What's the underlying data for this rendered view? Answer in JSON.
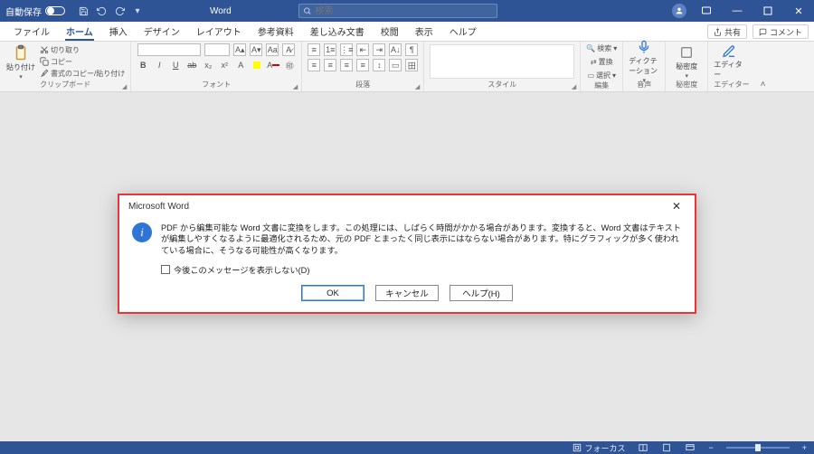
{
  "titlebar": {
    "autosave_label": "自動保存",
    "autosave_on": false,
    "app_name": "Word",
    "search_placeholder": "検索"
  },
  "tabs": {
    "items": [
      "ファイル",
      "ホーム",
      "挿入",
      "デザイン",
      "レイアウト",
      "参考資料",
      "差し込み文書",
      "校閲",
      "表示",
      "ヘルプ"
    ],
    "active_index": 1,
    "share_label": "共有",
    "comment_label": "コメント"
  },
  "ribbon": {
    "clipboard": {
      "label": "クリップボード",
      "paste": "貼り付け",
      "cut": "切り取り",
      "copy": "コピー",
      "fmt": "書式のコピー/貼り付け"
    },
    "font": {
      "label": "フォント"
    },
    "paragraph": {
      "label": "段落"
    },
    "styles": {
      "label": "スタイル"
    },
    "editing": {
      "label": "編集",
      "find": "検索",
      "replace": "置換",
      "select": "選択"
    },
    "dictation": {
      "label": "音声",
      "btn": "ディクテーション"
    },
    "sensitivity": {
      "label": "秘密度",
      "btn": "秘密度"
    },
    "editor": {
      "label": "エディター",
      "btn": "エディター"
    }
  },
  "dialog": {
    "title": "Microsoft Word",
    "message": "PDF から編集可能な Word 文書に変換をします。この処理には、しばらく時間がかかる場合があります。変換すると、Word 文書はテキストが編集しやすくなるように最適化されるため、元の PDF とまったく同じ表示にはならない場合があります。特にグラフィックが多く使われている場合に、そうなる可能性が高くなります。",
    "checkbox_label": "今後このメッセージを表示しない(D)",
    "ok": "OK",
    "cancel": "キャンセル",
    "help": "ヘルプ(H)"
  },
  "status": {
    "focus": "フォーカス"
  }
}
